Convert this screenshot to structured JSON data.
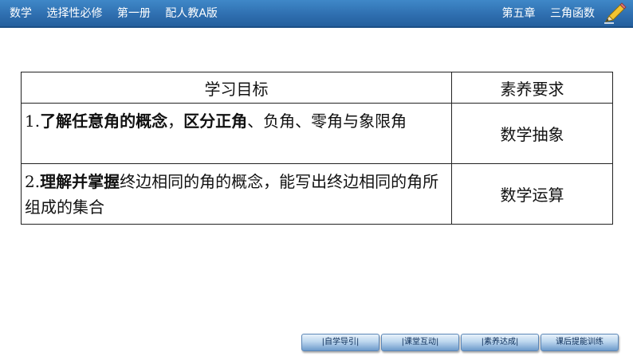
{
  "header": {
    "left_items": [
      "数学",
      "选择性必修",
      "第一册",
      "配人教A版"
    ],
    "chapter": "第五章",
    "topic": "三角函数"
  },
  "table": {
    "headers": [
      "学习目标",
      "素养要求"
    ],
    "rows": [
      {
        "objective_parts": [
          {
            "text": "1.",
            "bold": false
          },
          {
            "text": "了解任意角的概念",
            "bold": true
          },
          {
            "text": "，",
            "bold": false
          },
          {
            "text": "区分正角",
            "bold": true
          },
          {
            "text": "、负角、零角与象限角",
            "bold": false
          }
        ],
        "literacy": "数学抽象"
      },
      {
        "objective_parts": [
          {
            "text": "2.",
            "bold": false
          },
          {
            "text": "理解并掌握",
            "bold": true
          },
          {
            "text": "终边相同的角的概念，能写出终边相同的角所组成的集合",
            "bold": false
          }
        ],
        "literacy": "数学运算"
      }
    ]
  },
  "nav": {
    "btn1": "|自学导引|",
    "btn2": "|课堂互动|",
    "btn3": "|素养达成|",
    "btn4": "课后提能训练"
  },
  "colors": {
    "header_blue": "#2f6fb0",
    "nav_text": "#0b2c57"
  }
}
